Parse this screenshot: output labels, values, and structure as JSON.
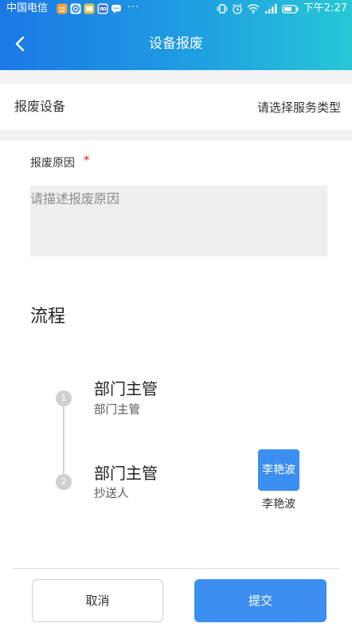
{
  "status_bar": {
    "carrier": "中国电信",
    "more": "···",
    "time": "下午2:27"
  },
  "header": {
    "title": "设备报废",
    "back_icon": "chevron-left-icon"
  },
  "equipment_row": {
    "label": "报废设备",
    "value": "请选择服务类型"
  },
  "reason": {
    "label": "报废原因",
    "required_mark": "*",
    "placeholder": "请描述报废原因"
  },
  "process": {
    "title": "流程",
    "steps": [
      {
        "index": "1",
        "name": "部门主管",
        "role": "部门主管"
      },
      {
        "index": "2",
        "name": "部门主管",
        "role": "抄送人",
        "assignee": {
          "avatar_text": "李艳波",
          "name": "李艳波"
        }
      }
    ]
  },
  "footer": {
    "cancel_label": "取消",
    "submit_label": "提交"
  },
  "colors": {
    "header_start": "#1b78e6",
    "header_end": "#27c7d7",
    "accent": "#3b8ff0",
    "required": "#e02020",
    "input_bg": "#eeeeee",
    "page_band": "#f2f2f2"
  }
}
